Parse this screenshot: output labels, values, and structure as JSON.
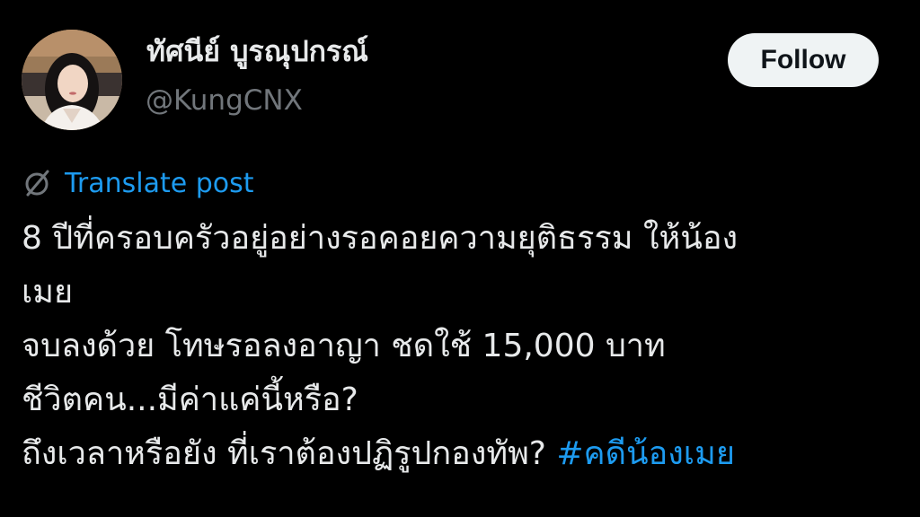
{
  "colors": {
    "background": "#000000",
    "primary_text": "#e7e9ea",
    "secondary_text": "#71767b",
    "link": "#1d9bf0",
    "follow_button_bg": "#eff3f4",
    "follow_button_text": "#0f1419"
  },
  "author": {
    "display_name": "ทัศนีย์ บูรณุปกรณ์",
    "handle": "@KungCNX",
    "avatar_icon": "profile-photo"
  },
  "follow_button": {
    "label": "Follow"
  },
  "translate": {
    "icon": "globe-slash-icon",
    "label": "Translate post"
  },
  "post": {
    "lines": [
      "8 ปีที่ครอบครัวอยู่อย่างรอคอยความยุติธรรม ให้น้อง",
      "เมย",
      "จบลงด้วย โทษรอลงอาญา ชดใช้ 15,000 บาท",
      "ชีวิตคน...มีค่าแค่นี้หรือ?",
      "ถึงเวลาหรือยัง ที่เราต้องปฏิรูปกองทัพ? "
    ],
    "hashtag": "#คดีน้องเมย"
  }
}
